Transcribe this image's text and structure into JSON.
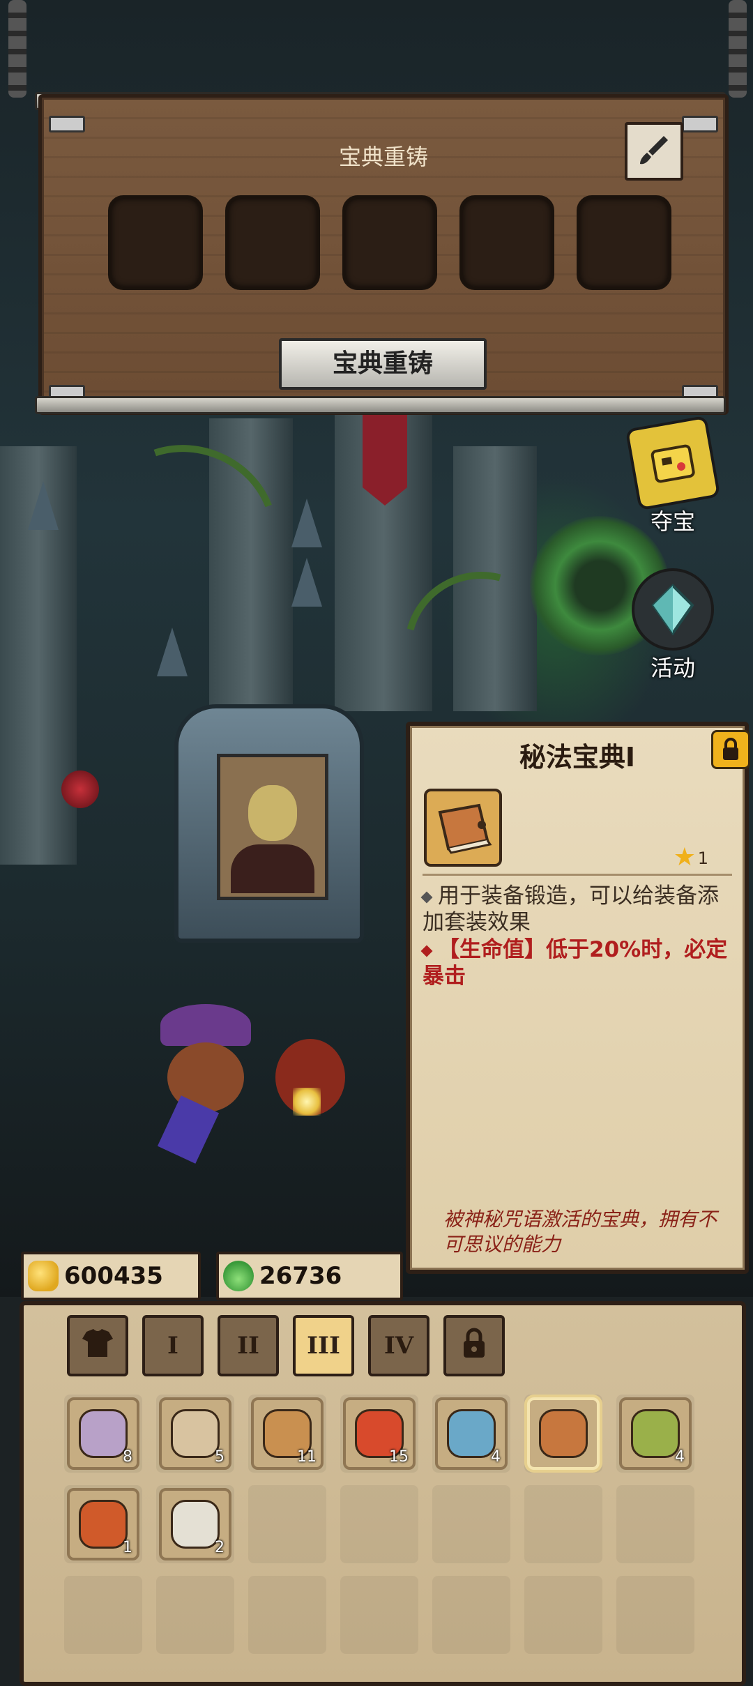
{
  "forge": {
    "title": "宝典重铸",
    "button_label": "宝典重铸",
    "slot_count": 5
  },
  "side_menu": [
    {
      "label": "夺宝",
      "icon": "treasure-chest-icon"
    },
    {
      "label": "活动",
      "icon": "crystal-icon"
    }
  ],
  "item_card": {
    "name": "秘法宝典Ⅰ",
    "star_count": "1",
    "descriptions": [
      {
        "text": "用于装备锻造，可以给装备添加套装效果",
        "color": "#3b2e22"
      },
      {
        "text": "【生命值】低于20%时，必定暴击",
        "color": "#b01e1e"
      }
    ],
    "flavor": "被神秘咒语激活的宝典，拥有不可思议的能力"
  },
  "currency": {
    "gold": "600435",
    "soul": "26736"
  },
  "tabs": [
    {
      "label": "",
      "icon": "armor-icon",
      "active": false
    },
    {
      "label": "I",
      "active": false
    },
    {
      "label": "II",
      "active": false
    },
    {
      "label": "III",
      "active": true
    },
    {
      "label": "IV",
      "active": false
    },
    {
      "label": "",
      "icon": "lock-icon",
      "active": false
    }
  ],
  "materials": [
    {
      "name": "pearl-orb",
      "count": "8",
      "color": "#b8a1c8"
    },
    {
      "name": "gear-part",
      "count": "5",
      "color": "#d8c3a0"
    },
    {
      "name": "horn",
      "count": "11",
      "color": "#c99050"
    },
    {
      "name": "red-gem",
      "count": "15",
      "color": "#d84a2c"
    },
    {
      "name": "blue-gem",
      "count": "4",
      "color": "#6aa8c8"
    },
    {
      "name": "arcane-codex",
      "count": "",
      "color": "#c7773e",
      "selected": true
    },
    {
      "name": "green-moss",
      "count": "4",
      "color": "#9ab04a"
    },
    {
      "name": "demon-eye",
      "count": "1",
      "color": "#d05a2a"
    },
    {
      "name": "bone",
      "count": "2",
      "color": "#e4e0d4"
    }
  ],
  "colors": {
    "accent_gold": "#f0b21c",
    "wood": "#6c4c33",
    "parchment": "#e9dbbd"
  }
}
